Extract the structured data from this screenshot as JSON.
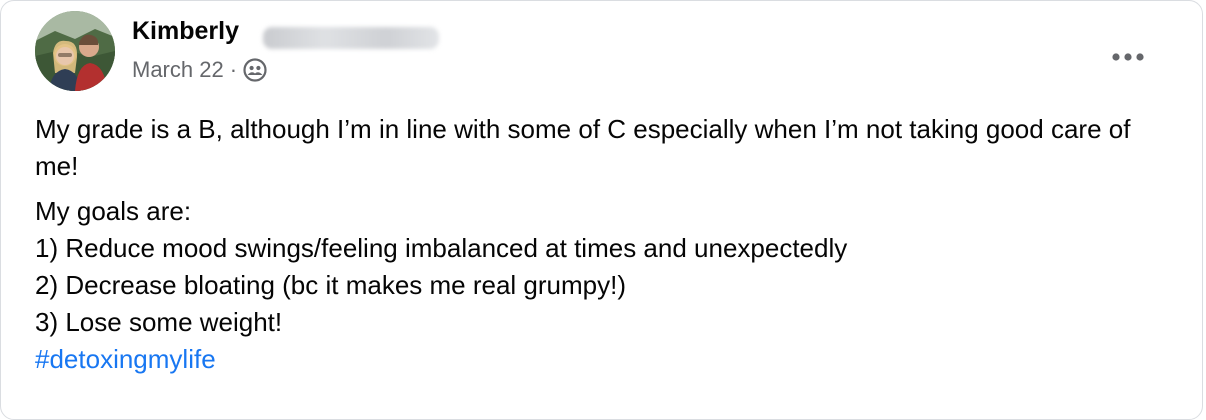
{
  "post": {
    "author_name": "Kimberly",
    "date": "March 22",
    "separator": "·",
    "audience_icon": "friends-icon",
    "more_icon": "more-options-icon",
    "paragraph1": "My grade is a B, although I’m in line with some of C especially when I’m not taking good care of me!",
    "goals_heading": "My goals are:",
    "goals": [
      "1) Reduce mood swings/feeling imbalanced at times and unexpectedly",
      "2) Decrease bloating (bc it makes me real grumpy!)",
      "3) Lose some weight!"
    ],
    "hashtag": "#detoxingmylife"
  },
  "colors": {
    "text": "#050505",
    "secondary_text": "#65676b",
    "link": "#1877f2",
    "border": "#dadde1"
  }
}
